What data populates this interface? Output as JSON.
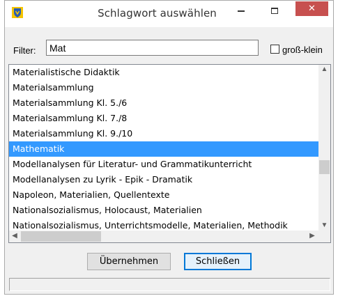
{
  "window": {
    "title": "Schlagwort auswählen",
    "close_glyph": "✕",
    "icons": {
      "app": "shield-app-icon",
      "minimize": "minimize-icon",
      "maximize": "maximize-icon",
      "close": "close-icon"
    }
  },
  "filter": {
    "label": "Filter:",
    "value": "Mat",
    "case_sensitive_label": "groß-klein",
    "case_sensitive_checked": false
  },
  "list": {
    "items": [
      "Materialistische Didaktik",
      "Materialsammlung",
      "Materialsammlung Kl. 5./6",
      "Materialsammlung Kl. 7./8",
      "Materialsammlung Kl. 9./10",
      "Mathematik",
      "Modellanalysen für Literatur- und Grammatikunterricht",
      "Modellanalysen zu Lyrik - Epik - Dramatik",
      "Napoleon, Materialien, Quellentexte",
      "Nationalsozialismus, Holocaust, Materialien",
      "Nationalsozialismus, Unterrichtsmodelle, Materialien, Methodik"
    ],
    "selected_index": 5,
    "scroll_glyphs": {
      "up": "▲",
      "down": "▼",
      "left": "◀",
      "right": "▶"
    }
  },
  "buttons": {
    "apply_label": "Übernehmen",
    "close_label": "Schließen"
  },
  "status": {
    "text": ""
  },
  "colors": {
    "selection": "#3399ff",
    "close_button": "#c7504f"
  }
}
